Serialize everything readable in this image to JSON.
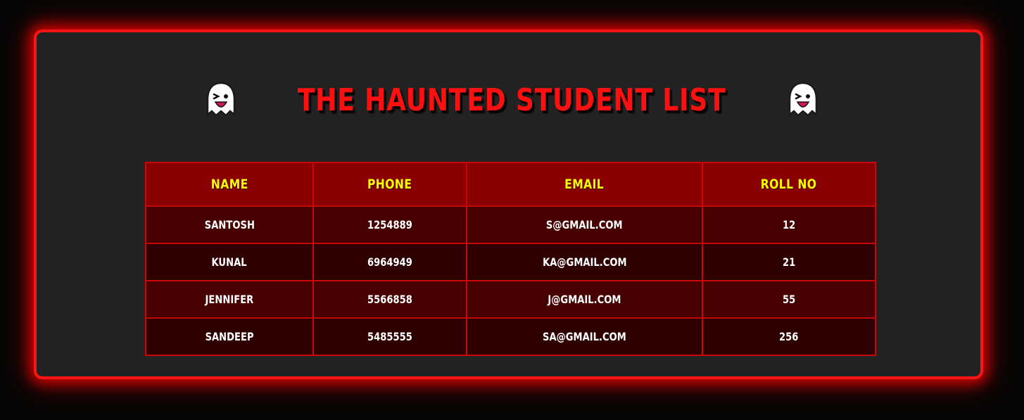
{
  "page": {
    "title": "The Haunted Student List",
    "title_icon_left": "ghost-icon",
    "title_icon_right": "ghost-icon"
  },
  "colors": {
    "background": "#050505",
    "panel": "#222222",
    "glow_border": "#ff1414",
    "title": "#ff0f0f",
    "header_bg": "#8a0000",
    "header_text": "#ffff00",
    "row_odd": "#470000",
    "row_even": "#2e0000",
    "cell_text": "#ffffff"
  },
  "table": {
    "headers": [
      "Name",
      "Phone",
      "Email",
      "Roll No"
    ],
    "rows": [
      [
        "Santosh",
        "1254889",
        "s@gmail.com",
        "12"
      ],
      [
        "Kunal",
        "6964949",
        "ka@gmail.com",
        "21"
      ],
      [
        "Jennifer",
        "5566858",
        "j@gmail.com",
        "55"
      ],
      [
        "Sandeep",
        "5485555",
        "sa@gmail.com",
        "256"
      ]
    ]
  }
}
